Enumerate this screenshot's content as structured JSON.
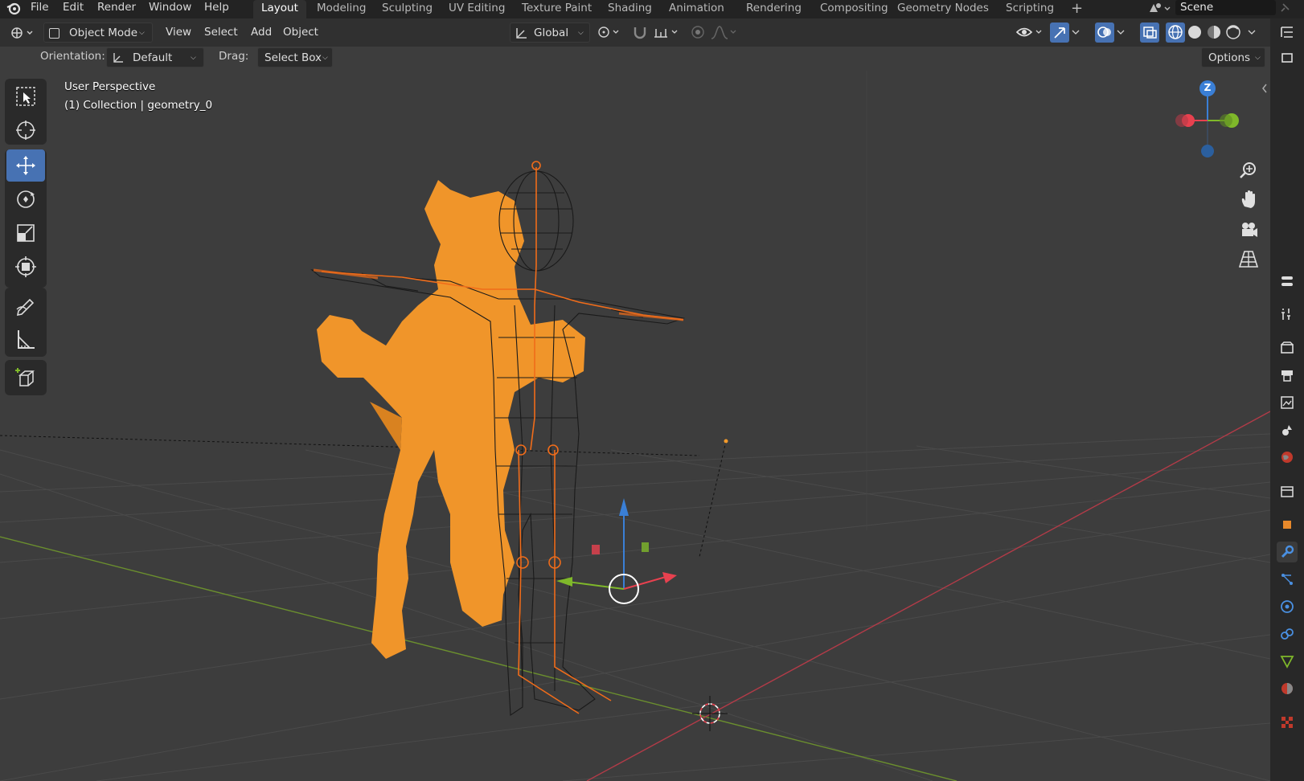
{
  "menu": {
    "items": [
      "File",
      "Edit",
      "Render",
      "Window",
      "Help"
    ]
  },
  "workspaces": {
    "tabs": [
      "Layout",
      "Modeling",
      "Sculpting",
      "UV Editing",
      "Texture Paint",
      "Shading",
      "Animation",
      "Rendering",
      "Compositing",
      "Geometry Nodes",
      "Scripting"
    ],
    "active": "Layout",
    "add_label": "+"
  },
  "scene": {
    "name": "Scene"
  },
  "header": {
    "mode": "Object Mode",
    "menus": [
      "View",
      "Select",
      "Add",
      "Object"
    ],
    "transform_orientation": "Global",
    "options_label": "Options"
  },
  "tool_settings": {
    "orientation_label": "Orientation:",
    "orientation_value": "Default",
    "drag_label": "Drag:",
    "drag_value": "Select Box"
  },
  "viewport": {
    "perspective_label": "User Perspective",
    "collection_label": "(1) Collection | geometry_0",
    "gizmo_z_label": "Z"
  },
  "colors": {
    "accent": "#4772b3",
    "selection_orange": "#f39a2b",
    "axis_x": "#e8414f",
    "axis_y": "#7fb82a",
    "axis_z": "#3a7fd6",
    "viewport_bg": "#3d3d3d"
  },
  "toolbar": {
    "tools": [
      "select-box-icon",
      "cursor-icon",
      "move-icon",
      "rotate-icon",
      "scale-icon",
      "transform-icon",
      "annotate-icon",
      "measure-icon",
      "add-cube-icon"
    ],
    "active": "move-icon"
  },
  "properties_tabs": [
    "tool-icon",
    "render-icon",
    "output-icon",
    "view-layer-icon",
    "scene-icon",
    "world-icon",
    "collection-icon",
    "object-icon",
    "modifier-icon",
    "particles-icon",
    "physics-icon",
    "constraints-icon",
    "data-icon",
    "material-icon",
    "texture-icon"
  ],
  "properties_active": "modifier-icon"
}
